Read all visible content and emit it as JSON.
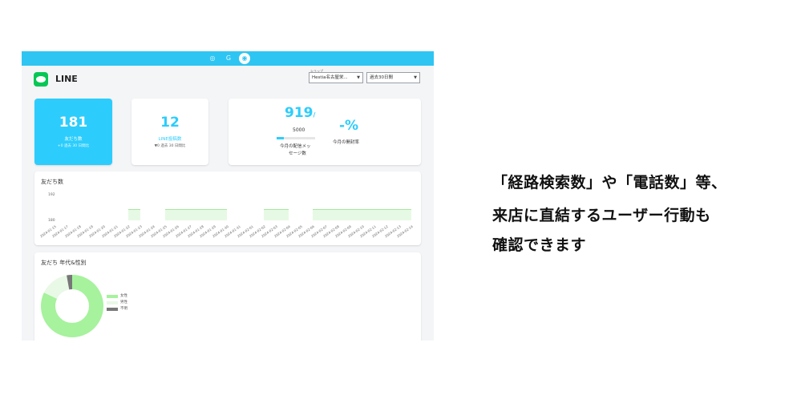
{
  "topbar": {
    "icons": [
      "instagram-icon",
      "google-icon",
      "line-icon"
    ],
    "glyphs": [
      "◎",
      "G",
      "◉"
    ]
  },
  "app": {
    "title": "LINE"
  },
  "filters": {
    "store_label": "ショップ",
    "store_value": "Hestia名古屋栄...",
    "period_value": "過去30日間"
  },
  "stats": {
    "friends": {
      "value": "181",
      "label": "友だち数",
      "delta": "+0 過去 30 日間比"
    },
    "posts": {
      "value": "12",
      "label": "LINE投稿数",
      "delta": "▼0 過去 30 日間比"
    },
    "messages": {
      "value": "919",
      "suffix": "/",
      "limit": "5000",
      "label_line1": "今月の配信メッ",
      "label_line2": "セージ数",
      "progress": 0.18
    },
    "open_rate": {
      "value": "-%",
      "label": "今月の開封率"
    }
  },
  "friends_chart": {
    "title": "友だち数",
    "y_max_label": "192",
    "y_min_label": "180",
    "dates": [
      "2024-01-15",
      "2024-01-17",
      "2024-01-18",
      "2024-01-19",
      "2024-01-20",
      "2024-01-21",
      "2024-01-22",
      "2024-01-23",
      "2024-01-24",
      "2024-01-25",
      "2024-01-26",
      "2024-01-27",
      "2024-01-28",
      "2024-01-29",
      "2024-01-30",
      "2024-01-31",
      "2024-02-01",
      "2024-02-02",
      "2024-02-03",
      "2024-02-04",
      "2024-02-05",
      "2024-02-06",
      "2024-02-07",
      "2024-02-08",
      "2024-02-09",
      "2024-02-10",
      "2024-02-11",
      "2024-02-12",
      "2024-02-13",
      "2024-02-14"
    ]
  },
  "chart_data": {
    "type": "area",
    "title": "友だち数",
    "xlabel": "",
    "ylabel": "",
    "y_tick_labels": [
      "192",
      "180"
    ],
    "segments": [
      {
        "start": "2024-01-22",
        "end": "2024-01-23"
      },
      {
        "start": "2024-01-25",
        "end": "2024-01-30"
      },
      {
        "start": "2024-02-02",
        "end": "2024-02-04"
      },
      {
        "start": "2024-02-06",
        "end": "2024-02-14"
      }
    ],
    "value": 181
  },
  "demographics": {
    "title": "友だち 年代&性別",
    "legend": [
      {
        "label": "女性",
        "color": "#a6f29d"
      },
      {
        "label": "男性",
        "color": "#e8f9e6"
      },
      {
        "label": "不明",
        "color": "#777777"
      }
    ],
    "shares": [
      0.82,
      0.15,
      0.03
    ]
  },
  "caption": {
    "line1": "「経路検索数」や「電話数」等、",
    "line2": "来店に直結するユーザー行動も",
    "line3": "確認できます"
  }
}
